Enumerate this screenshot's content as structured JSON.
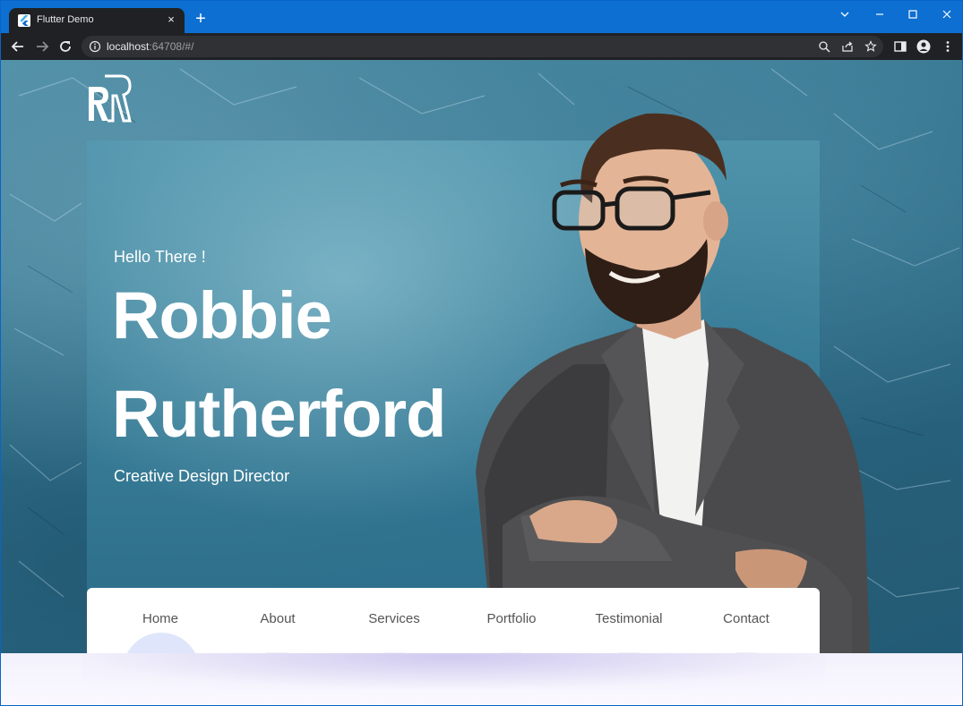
{
  "browser": {
    "tab_title": "Flutter Demo",
    "tab_close": "×",
    "new_tab": "+",
    "url_host": "localhost",
    "url_rest": ":64708/#/"
  },
  "hero": {
    "greeting": "Hello There !",
    "first_name": "Robbie",
    "last_name": "Rutherford",
    "role": "Creative Design Director"
  },
  "nav": {
    "items": [
      "Home",
      "About",
      "Services",
      "Portfolio",
      "Testimonial",
      "Contact"
    ],
    "active": "Home"
  },
  "colors": {
    "accent": "#0d6fd1",
    "hero_bg": "#3b7f99",
    "text_on_hero": "#ffffff"
  }
}
